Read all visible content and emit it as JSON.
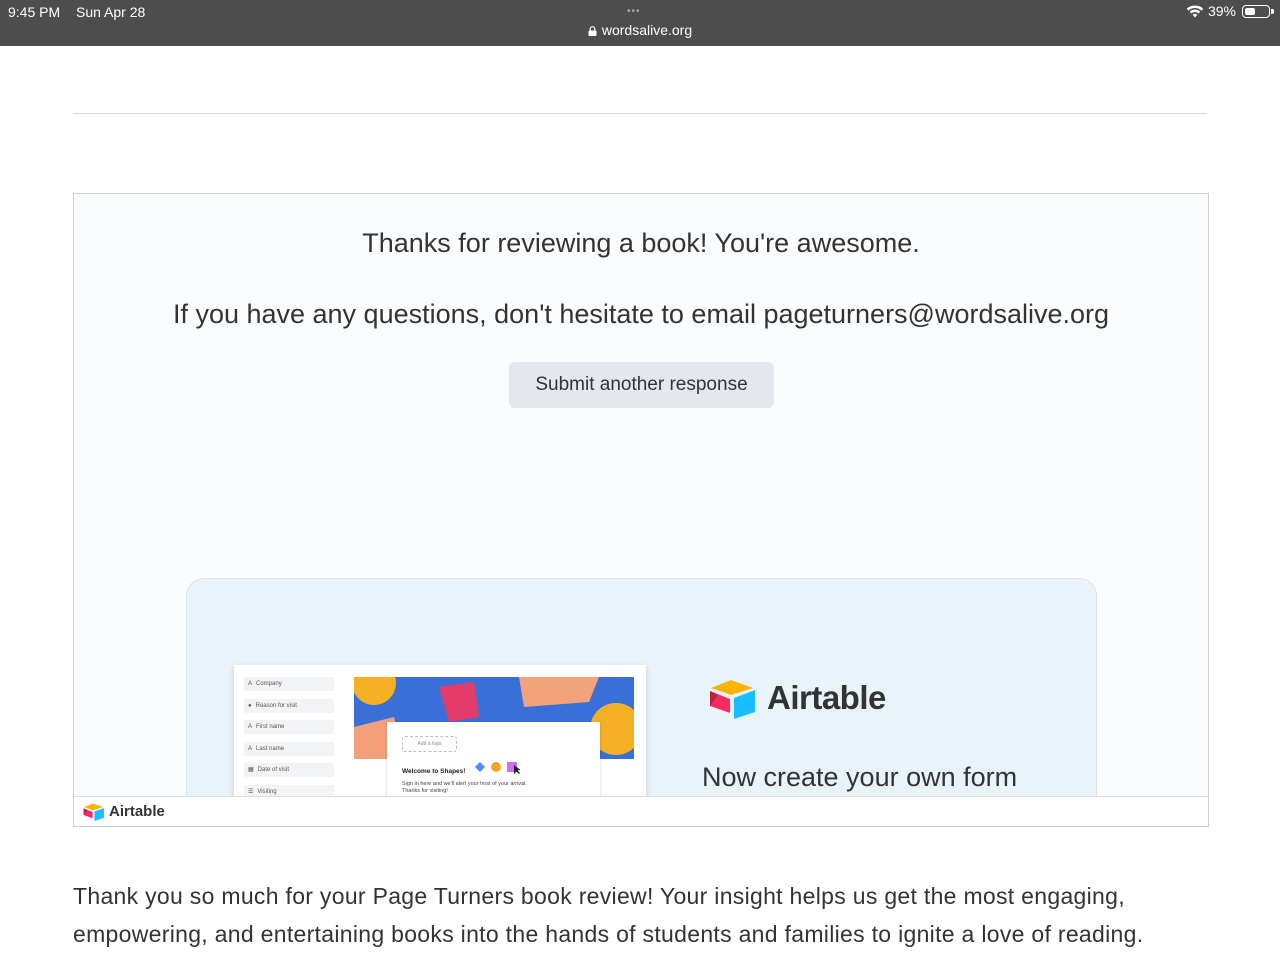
{
  "status_bar": {
    "time": "9:45 PM",
    "date": "Sun Apr 28",
    "dots": "•••",
    "url": "wordsalive.org",
    "battery": "39%",
    "battery_level": 0.39,
    "icons": [
      "lock-icon",
      "wifi-icon",
      "battery-icon"
    ]
  },
  "form": {
    "thanks_message": "Thanks for reviewing a book! You're awesome.",
    "questions_message": "If you have any questions, don't hesitate to email pageturners@wordsalive.org",
    "submit_another_label": "Submit another response"
  },
  "promo": {
    "brand": "Airtable",
    "headline": "Now create your own form",
    "mock_fields": [
      "Company",
      "Reason for visit",
      "First name",
      "Last name",
      "Date of visit",
      "Visiting"
    ],
    "mock_add_logo": "Add a logo",
    "mock_welcome": "Welcome to Shapes!",
    "mock_sign_in": "Sign in here and we'll alert your host of your arrival.",
    "mock_thanks": "Thanks for visiting!"
  },
  "embed_footer": {
    "brand": "Airtable"
  },
  "closing_text": "Thank you so much for your Page Turners book review! Your insight helps us get the most engaging, empowering, and entertaining books into the hands of students and families to ignite a love of reading.",
  "colors": {
    "status_bar": "#4d4d4d",
    "button_bg": "#e4e8ee",
    "promo_bg": "#e8f3fa",
    "airtable_yellow": "#fcb400",
    "airtable_blue": "#18bfff",
    "airtable_red": "#f82b60"
  }
}
